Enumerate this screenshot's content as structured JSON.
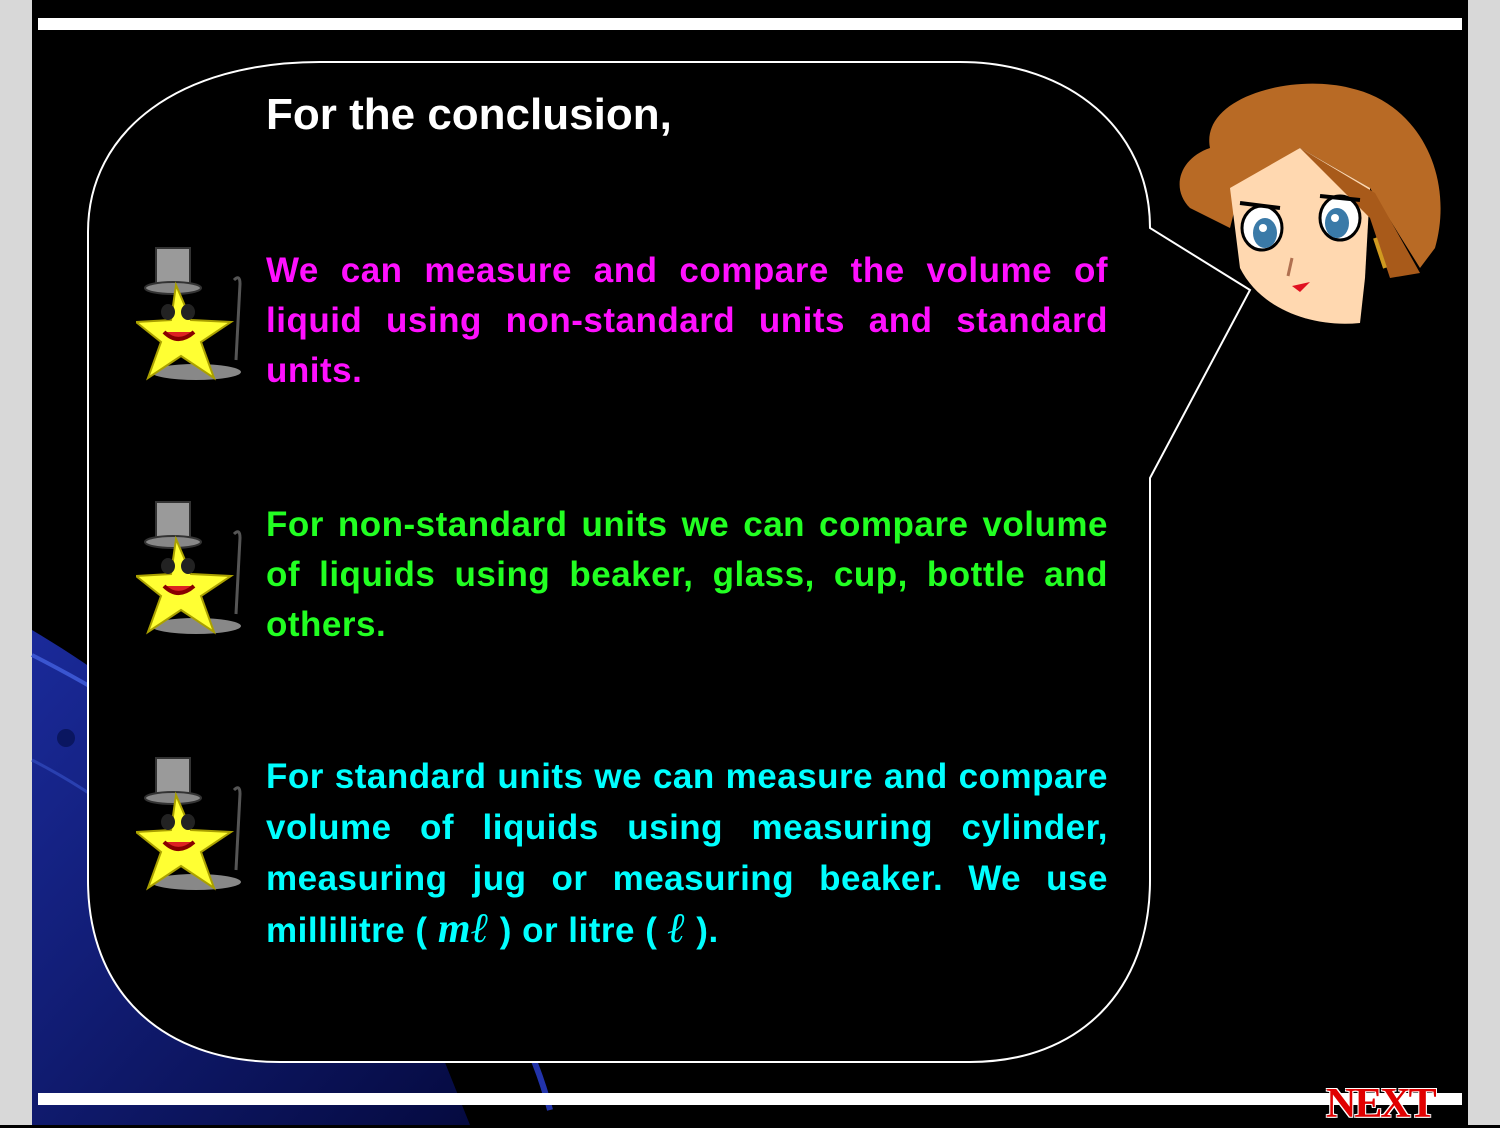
{
  "slide": {
    "title": "For the conclusion,",
    "points": [
      {
        "text": "We can measure and compare the volume of liquid using non-standard units and standard units.",
        "color": "#ff10ff"
      },
      {
        "text": "For non-standard units we can compare volume of liquids using beaker, glass, cup, bottle and others.",
        "color": "#22ff22"
      },
      {
        "text_part1": "For standard units we can measure and compare volume of liquids using measuring cylinder, measuring jug or measuring beaker. We use millilitre (",
        "unit_ml": "mℓ",
        "text_part2": ") or litre (",
        "unit_l": "ℓ",
        "text_part3": ").",
        "color": "#00ffff"
      }
    ],
    "next_label": "NEXT"
  },
  "colors": {
    "background": "#000000",
    "frame": "#d8d8d8",
    "bubble_outline": "#ffffff",
    "next": "#e00000"
  },
  "icons": [
    "star-with-top-hat-icon",
    "anime-girl-face-icon",
    "blue-swoosh-decoration"
  ]
}
